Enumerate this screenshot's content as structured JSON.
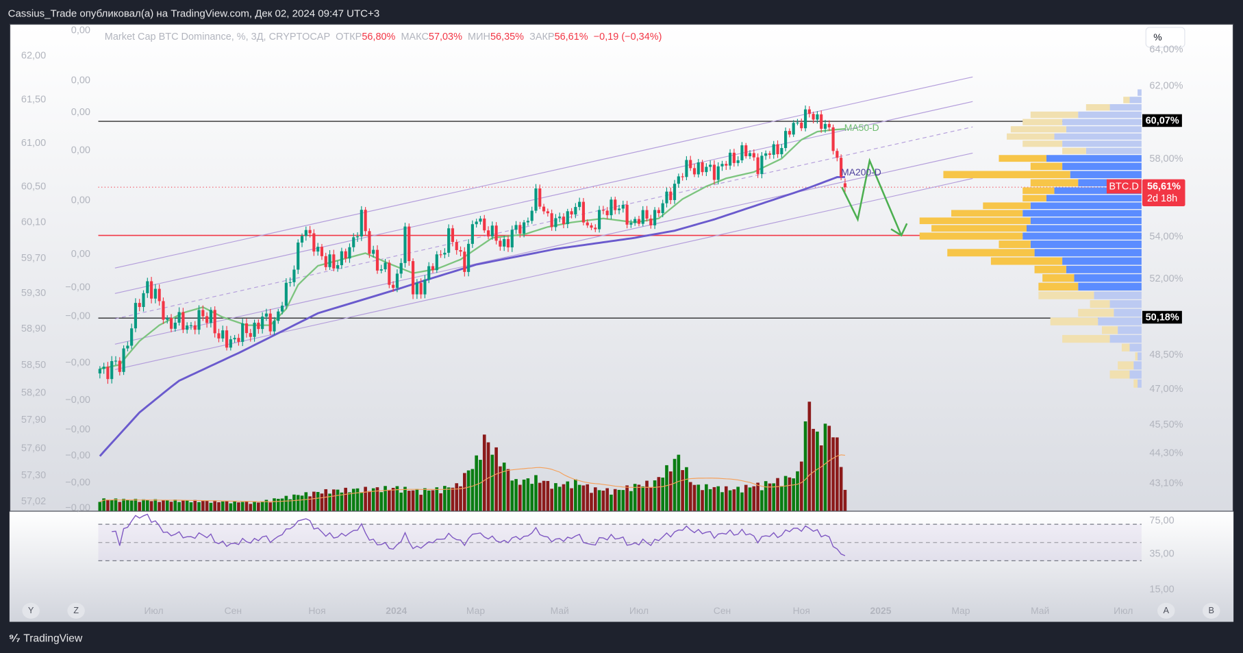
{
  "header": {
    "published": "Cassius_Trade опубликовал(а) на TradingView.com, Дек 02, 2024 09:47 UTC+3"
  },
  "legend": {
    "title": "Market Cap BTC Dominance, %, 3Д, CRYPTOCAP",
    "open_label": "ОТКР",
    "open": "56,80%",
    "high_label": "МАКС",
    "high": "57,03%",
    "low_label": "МИН",
    "low": "56,35%",
    "close_label": "ЗАКР",
    "close": "56,61%",
    "change": "−0,19 (−0,34%)"
  },
  "scale_button": "%",
  "left_axis_outer": [
    "62,00",
    "61,50",
    "61,00",
    "60,50",
    "60,10",
    "59,70",
    "59,30",
    "58,90",
    "58,50",
    "58,20",
    "57,90",
    "57,60",
    "57,30",
    "57,02"
  ],
  "left_axis_inner": [
    "0,00",
    "0,00",
    "0,00",
    "0,00",
    "0,00",
    "0,00",
    "−0,00",
    "−0,00",
    "−0,00",
    "−0,00",
    "−0,00",
    "−0,00",
    "−0,00",
    "−0,00"
  ],
  "right_axis": [
    "64,00%",
    "62,00%",
    "58,00%",
    "54,00%",
    "52,00%",
    "48,50%",
    "47,00%",
    "45,50%",
    "44,30%",
    "43,10%"
  ],
  "rsi_axis": [
    "75,00",
    "35,00",
    "15,00"
  ],
  "levels": {
    "upper": "60,07%",
    "lower": "50,18%",
    "upper_value": 60.07,
    "lower_value": 50.18,
    "support_value": 54.05
  },
  "current": {
    "symbol": "BTC.D",
    "price": "56,61%",
    "countdown": "2d 18h",
    "value": 56.61
  },
  "ma_labels": {
    "ma50": "MA50-D",
    "ma200": "MA200-D"
  },
  "time_axis": [
    "Июл",
    "Сен",
    "Ноя",
    "2024",
    "Мар",
    "Май",
    "Июл",
    "Сен",
    "Ноя",
    "2025",
    "Мар",
    "Май",
    "Июл"
  ],
  "nav_buttons": [
    "Y",
    "Z",
    "A",
    "B"
  ],
  "footer": {
    "brand": "TradingView"
  },
  "colors": {
    "up": "#089981",
    "down": "#f23645",
    "vol_up": "#0a7d12",
    "vol_down": "#8b1a1a",
    "ma50": "#7cc47e",
    "ma200": "#6a5acd",
    "channel": "#b39ddb",
    "rsi": "#7e57c2",
    "arrow": "#4caf50"
  },
  "chart_data": {
    "type": "candlestick",
    "timeframe": "3D",
    "candle_count": 189,
    "close_keypoints": [
      [
        0,
        47.87
      ],
      [
        5,
        47.97
      ],
      [
        8,
        49.85
      ],
      [
        12,
        51.85
      ],
      [
        17,
        50.03
      ],
      [
        23,
        49.85
      ],
      [
        28,
        50.4
      ],
      [
        30,
        49.12
      ],
      [
        35,
        49.3
      ],
      [
        41,
        50.03
      ],
      [
        44,
        50.03
      ],
      [
        47,
        51.3
      ],
      [
        51,
        54.2
      ],
      [
        54,
        53.8
      ],
      [
        57,
        52.6
      ],
      [
        63,
        53.2
      ],
      [
        66,
        55.2
      ],
      [
        68,
        53.2
      ],
      [
        72,
        52.4
      ],
      [
        74,
        51.3
      ],
      [
        77,
        54.2
      ],
      [
        79,
        51.3
      ],
      [
        83,
        52.2
      ],
      [
        88,
        54.0
      ],
      [
        92,
        52.8
      ],
      [
        95,
        55.0
      ],
      [
        101,
        53.6
      ],
      [
        107,
        54.6
      ],
      [
        110,
        56.0
      ],
      [
        115,
        54.6
      ],
      [
        120,
        55.6
      ],
      [
        124,
        54.4
      ],
      [
        129,
        55.8
      ],
      [
        134,
        54.8
      ],
      [
        139,
        55.0
      ],
      [
        142,
        55.6
      ],
      [
        145,
        56.8
      ],
      [
        149,
        57.7
      ],
      [
        153,
        57.4
      ],
      [
        157,
        57.6
      ],
      [
        162,
        58.4
      ],
      [
        166,
        57.8
      ],
      [
        172,
        58.8
      ],
      [
        175,
        59.8
      ],
      [
        178,
        60.4
      ],
      [
        181,
        60.2
      ],
      [
        183,
        60.0
      ],
      [
        185,
        58.6
      ],
      [
        187,
        57.2
      ]
    ],
    "last_candle": {
      "open": 56.8,
      "high": 57.03,
      "low": 56.35,
      "close": 56.61
    },
    "ma50_keypoints": [
      [
        0,
        47.87
      ],
      [
        5,
        48.05
      ],
      [
        10,
        49.12
      ],
      [
        15,
        49.85
      ],
      [
        21,
        50.42
      ],
      [
        26,
        50.68
      ],
      [
        31,
        50.22
      ],
      [
        37,
        49.85
      ],
      [
        43,
        49.85
      ],
      [
        47,
        50.6
      ],
      [
        50,
        51.7
      ],
      [
        55,
        52.6
      ],
      [
        61,
        52.9
      ],
      [
        67,
        53.2
      ],
      [
        73,
        52.7
      ],
      [
        79,
        52.25
      ],
      [
        85,
        52.45
      ],
      [
        91,
        52.9
      ],
      [
        99,
        53.93
      ],
      [
        107,
        54.1
      ],
      [
        113,
        54.5
      ],
      [
        119,
        54.74
      ],
      [
        127,
        54.95
      ],
      [
        135,
        54.74
      ],
      [
        141,
        54.95
      ],
      [
        147,
        55.98
      ],
      [
        153,
        56.65
      ],
      [
        158,
        57.04
      ],
      [
        165,
        57.35
      ],
      [
        172,
        58.0
      ],
      [
        177,
        59.05
      ],
      [
        181,
        59.5
      ],
      [
        185,
        59.6
      ],
      [
        188,
        59.65
      ]
    ],
    "ma200_keypoints": [
      [
        0,
        44.17
      ],
      [
        10,
        46.0
      ],
      [
        20,
        47.35
      ],
      [
        35,
        48.57
      ],
      [
        55,
        50.4
      ],
      [
        75,
        51.5
      ],
      [
        95,
        52.66
      ],
      [
        115,
        53.4
      ],
      [
        135,
        53.93
      ],
      [
        145,
        54.3
      ],
      [
        155,
        54.9
      ],
      [
        175,
        56.3
      ],
      [
        186,
        57.1
      ],
      [
        188,
        57.1
      ]
    ],
    "volume_keypoints": [
      [
        0,
        16
      ],
      [
        20,
        14
      ],
      [
        40,
        12
      ],
      [
        50,
        22
      ],
      [
        58,
        28
      ],
      [
        66,
        30
      ],
      [
        75,
        32
      ],
      [
        80,
        28
      ],
      [
        85,
        30
      ],
      [
        90,
        35
      ],
      [
        95,
        70
      ],
      [
        97,
        100
      ],
      [
        100,
        80
      ],
      [
        105,
        40
      ],
      [
        110,
        45
      ],
      [
        115,
        35
      ],
      [
        120,
        40
      ],
      [
        125,
        30
      ],
      [
        130,
        28
      ],
      [
        135,
        35
      ],
      [
        140,
        40
      ],
      [
        146,
        75
      ],
      [
        150,
        35
      ],
      [
        160,
        30
      ],
      [
        170,
        40
      ],
      [
        176,
        50
      ],
      [
        179,
        150
      ],
      [
        181,
        100
      ],
      [
        183,
        115
      ],
      [
        185,
        115
      ],
      [
        187,
        70
      ],
      [
        188,
        28
      ]
    ],
    "volume_profile": [
      [
        61.6,
        5,
        0
      ],
      [
        61.2,
        15,
        8
      ],
      [
        60.8,
        40,
        30
      ],
      [
        60.4,
        80,
        60
      ],
      [
        60.0,
        100,
        50
      ],
      [
        59.6,
        95,
        70
      ],
      [
        59.2,
        110,
        60
      ],
      [
        58.8,
        100,
        50
      ],
      [
        58.4,
        70,
        30
      ],
      [
        58.0,
        120,
        60
      ],
      [
        57.6,
        100,
        40
      ],
      [
        57.2,
        90,
        160
      ],
      [
        56.8,
        80,
        60
      ],
      [
        56.4,
        110,
        40
      ],
      [
        56.0,
        120,
        30
      ],
      [
        55.6,
        140,
        60
      ],
      [
        55.2,
        150,
        90
      ],
      [
        54.8,
        140,
        140
      ],
      [
        54.4,
        145,
        120
      ],
      [
        54.0,
        150,
        130
      ],
      [
        53.6,
        140,
        40
      ],
      [
        53.2,
        135,
        110
      ],
      [
        52.8,
        100,
        90
      ],
      [
        52.4,
        95,
        40
      ],
      [
        52.0,
        85,
        40
      ],
      [
        51.6,
        80,
        50
      ],
      [
        51.2,
        60,
        70
      ],
      [
        50.8,
        40,
        25
      ],
      [
        50.4,
        35,
        45
      ],
      [
        50.0,
        55,
        60
      ],
      [
        49.6,
        30,
        20
      ],
      [
        49.2,
        40,
        60
      ],
      [
        48.8,
        15,
        10
      ],
      [
        48.4,
        5,
        3
      ],
      [
        48.0,
        10,
        20
      ],
      [
        47.6,
        15,
        25
      ],
      [
        47.2,
        5,
        5
      ]
    ],
    "value_area": [
      51.4,
      58.2
    ],
    "rsi_bands": [
      70,
      50,
      30
    ],
    "projection": [
      56.61,
      54.9,
      57.9,
      54.05
    ]
  }
}
